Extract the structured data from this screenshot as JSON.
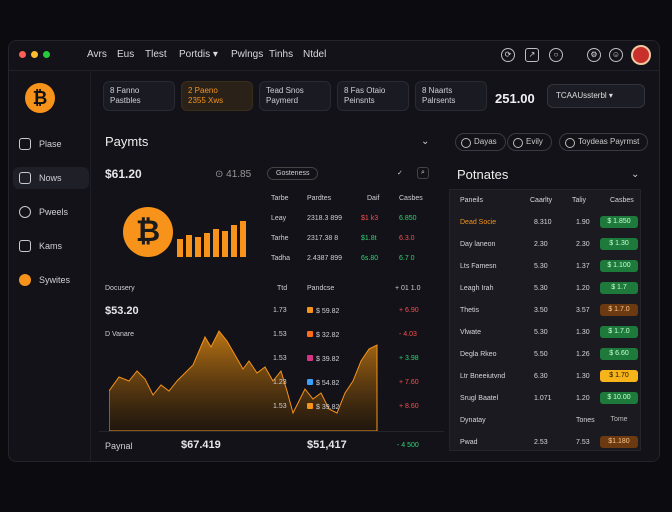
{
  "window": {
    "title": ""
  },
  "menu": [
    "Avrs",
    "Eus",
    "Tlest",
    "Portdis ▾",
    "Pwlngs",
    "Tinhs",
    "Ntdel"
  ],
  "sidebar": {
    "items": [
      {
        "label": "Plase"
      },
      {
        "label": "Nows"
      },
      {
        "label": "Pweels"
      },
      {
        "label": "Kams"
      },
      {
        "label": "Sywites"
      }
    ]
  },
  "cards": [
    {
      "top": "8  Fanno",
      "bottom": "Pastbles"
    },
    {
      "top": "2  Paeno",
      "bottom": "2355 Xws"
    },
    {
      "top": "Tead Snos",
      "bottom": "Paymerd"
    },
    {
      "top": "8  Fas Otaio",
      "bottom": "Peinsnts"
    },
    {
      "top": "8  Naarts",
      "bottom": "Palrsents"
    }
  ],
  "header_value": "251.00",
  "dropdown": "TCAAUssterbl ▾",
  "left_panel": {
    "title": "Paymts",
    "amount": "$61.20",
    "amount2": "⊙ 41.85",
    "tag": "Gosteness",
    "table_head": [
      "Tarbe",
      "Pardtes",
      "Daif",
      "Casbes"
    ],
    "table_rows": [
      [
        "Leay",
        "2318.3 899",
        "$1 k3",
        "6.850"
      ],
      [
        "Tarhe",
        "2317.38 8",
        "$1.8t",
        "6.3.0"
      ],
      [
        "Tadha",
        "2.4387 899",
        "6s.80",
        "6.7 0"
      ]
    ],
    "chart_labels": {
      "left": "Docusery",
      "mid": "Ttd",
      "right": "Pandcse",
      "far": "+ 01 1.0"
    },
    "big": "$53.20",
    "sub": "D Vanare",
    "legend": [
      {
        "label": "$ 59.82",
        "val": "1.73"
      },
      {
        "label": "$ 32.82",
        "val": "1.53"
      },
      {
        "label": "$ 39.82",
        "val": "1.53"
      },
      {
        "label": "$ 54.82",
        "val": "1.23"
      },
      {
        "label": "$ 39.82",
        "val": "1.53"
      }
    ],
    "changes": [
      "+ 6.90",
      "- 4.03",
      "+ 3.98",
      "+ 7.60",
      "+ 8.60"
    ],
    "footer": {
      "label": "Paynal",
      "v1": "$67.419",
      "v2": "$51,417",
      "v3": "- 4 500"
    }
  },
  "right_panel": {
    "pills": [
      "Dayas",
      "Evily",
      "Toydeas Payrmst"
    ],
    "title": "Potnates",
    "head": [
      "Paneils",
      "Caarlty",
      "Taliy",
      "Casbes"
    ],
    "rows": [
      {
        "name": "Dead Socie",
        "c1": "8.310",
        "c2": "1.90",
        "badge": "$ 1.850",
        "tone": "g"
      },
      {
        "name": "Day laneon",
        "c1": "2.30",
        "c2": "2.30",
        "badge": "$ 1.30",
        "tone": "g"
      },
      {
        "name": "Lts Famesn",
        "c1": "5.30",
        "c2": "1.37",
        "badge": "$ 1.100",
        "tone": "g"
      },
      {
        "name": "Leagh Irah",
        "c1": "5.30",
        "c2": "1.20",
        "badge": "$ 1.7",
        "tone": "g"
      },
      {
        "name": "Thetis",
        "c1": "3.50",
        "c2": "3.57",
        "badge": "$ 1.7.0",
        "tone": "o"
      },
      {
        "name": "Vlwate",
        "c1": "5.30",
        "c2": "1.30",
        "badge": "$ 1.7.0",
        "tone": "g"
      },
      {
        "name": "Degla Rkeo",
        "c1": "5.50",
        "c2": "1.26",
        "badge": "$ 6.60",
        "tone": "g"
      },
      {
        "name": "Ltr Bneeiutvnd",
        "c1": "6.30",
        "c2": "1.30",
        "badge": "$ 1.70",
        "tone": "y"
      },
      {
        "name": "Srugl Baatel",
        "c1": "1.071",
        "c2": "1.20",
        "badge": "$ 10.00",
        "tone": "g"
      },
      {
        "name": "Dynatay",
        "c1": "",
        "c2": "Tones",
        "badge": "Tome",
        "tone": "n"
      },
      {
        "name": "Pwad",
        "c1": "2.53",
        "c2": "7.53",
        "badge": "$1.180",
        "tone": "o"
      }
    ]
  },
  "colors": {
    "accent": "#f7931a",
    "green": "#2ed573",
    "red": "#ff4d4d",
    "bg": "#121218"
  }
}
